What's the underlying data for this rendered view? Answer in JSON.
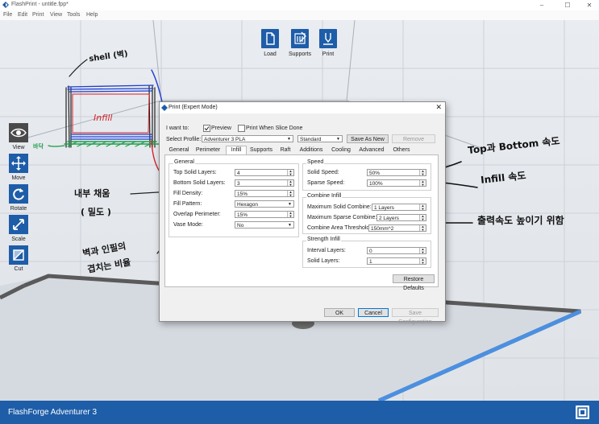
{
  "window": {
    "title": "FlashPrint - untitle.fpp*",
    "minimize": "–",
    "maximize": "☐",
    "close": "✕"
  },
  "menu": [
    "File",
    "Edit",
    "Print",
    "View",
    "Tools",
    "Help"
  ],
  "top_toolbar": [
    {
      "label": "Load",
      "icon": "load-icon"
    },
    {
      "label": "Supports",
      "icon": "supports-icon"
    },
    {
      "label": "Print",
      "icon": "print-icon"
    }
  ],
  "left_toolbar": [
    {
      "label": "View",
      "icon": "eye-icon"
    },
    {
      "label": "Move",
      "icon": "move-icon"
    },
    {
      "label": "Rotate",
      "icon": "rotate-icon"
    },
    {
      "label": "Scale",
      "icon": "scale-icon"
    },
    {
      "label": "Cut",
      "icon": "cut-icon"
    }
  ],
  "status_bar": {
    "machine": "FlashForge Adventurer 3"
  },
  "dialog": {
    "title": "Print (Expert Mode)",
    "i_want_to": "I want to:",
    "preview_label": "Preview",
    "preview_checked": true,
    "print_when_done_label": "Print When Slice Done",
    "print_when_done_checked": false,
    "select_profile_label": "Select Profile:",
    "profile": "Adventurer 3 PLA",
    "quality": "Standard",
    "save_as_new": "Save As New",
    "remove": "Remove",
    "tabs": [
      "General",
      "Perimeter",
      "Infill",
      "Supports",
      "Raft",
      "Additions",
      "Cooling",
      "Advanced",
      "Others"
    ],
    "active_tab": "Infill",
    "general_group": {
      "title": "General",
      "fields": [
        {
          "label": "Top Solid Layers:",
          "value": "4"
        },
        {
          "label": "Bottom Solid Layers:",
          "value": "3"
        },
        {
          "label": "Fill Density:",
          "value": "15%"
        },
        {
          "label": "Fill Pattern:",
          "value": "Hexagon"
        },
        {
          "label": "Overlap Perimeter:",
          "value": "15%"
        },
        {
          "label": "Vase Mode:",
          "value": "No"
        }
      ]
    },
    "speed_group": {
      "title": "Speed",
      "fields": [
        {
          "label": "Solid Speed:",
          "value": "50%"
        },
        {
          "label": "Sparse Speed:",
          "value": "100%"
        }
      ]
    },
    "combine_group": {
      "title": "Combine Infill",
      "fields": [
        {
          "label": "Maximum Solid Combine:",
          "value": "1 Layers"
        },
        {
          "label": "Maximum Sparse Combine:",
          "value": "2 Layers"
        },
        {
          "label": "Combine Area Threshold:",
          "value": "150mm^2"
        }
      ]
    },
    "strength_group": {
      "title": "Strength Infill",
      "fields": [
        {
          "label": "Interval Layers:",
          "value": "0"
        },
        {
          "label": "Solid Layers:",
          "value": "1"
        }
      ]
    },
    "restore_defaults": "Restore Defaults",
    "ok": "OK",
    "cancel": "Cancel",
    "save_configuration": "Save Configuration"
  },
  "annotations": {
    "shell": "shell (벽)",
    "infill": "Infill",
    "raft": "바닥",
    "internal_fill": "내부 채움",
    "density": "( 밀도 )",
    "overlap_1": "벽과 인필의",
    "overlap_2": "겹치는 비율",
    "top_bottom_speed": "Top과 Bottom 속도",
    "infill_speed": "Infill 속도",
    "speed_up": "출력속도 높이기 위함"
  },
  "colors": {
    "accent": "#1e5da8",
    "annotation_red": "#d8202a",
    "annotation_blue": "#1f3fd0",
    "raft_green": "#1e9e4a"
  }
}
